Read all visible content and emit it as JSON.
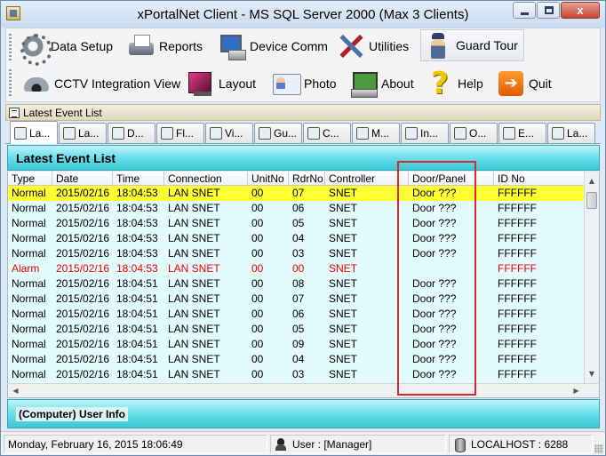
{
  "window": {
    "title": "xPortalNet Client - MS SQL Server 2000 (Max 3 Clients)",
    "controls": {
      "minimize": "",
      "maximize": "",
      "close": "x"
    }
  },
  "toolbar": {
    "row1": [
      {
        "label": "Data Setup",
        "icon": "gear-icon"
      },
      {
        "label": "Reports",
        "icon": "printer-icon"
      },
      {
        "label": "Device Comm",
        "icon": "device-comm-icon"
      },
      {
        "label": "Utilities",
        "icon": "tools-icon"
      },
      {
        "label": "Guard Tour",
        "icon": "guard-icon",
        "pressed": true
      }
    ],
    "row2": [
      {
        "label": "CCTV Integration View",
        "icon": "cctv-camera-icon"
      },
      {
        "label": "Layout",
        "icon": "monitor-icon"
      },
      {
        "label": "Photo",
        "icon": "photo-id-icon"
      },
      {
        "label": "About",
        "icon": "computer-icon"
      },
      {
        "label": "Help",
        "icon": "question-icon"
      },
      {
        "label": "Quit",
        "icon": "exit-icon"
      }
    ]
  },
  "panel": {
    "header": "Latest Event List"
  },
  "tabs": [
    {
      "label": "La...",
      "active": true
    },
    {
      "label": "La..."
    },
    {
      "label": "D..."
    },
    {
      "label": "Fl..."
    },
    {
      "label": "Vi..."
    },
    {
      "label": "Gu..."
    },
    {
      "label": "C..."
    },
    {
      "label": "M..."
    },
    {
      "label": "In..."
    },
    {
      "label": "O..."
    },
    {
      "label": "E..."
    },
    {
      "label": "La..."
    }
  ],
  "event_list": {
    "title": "Latest Event List",
    "columns": [
      "Type",
      "Date",
      "Time",
      "Connection",
      "UnitNo",
      "RdrNo",
      "Controller",
      "Door/Panel",
      "ID No"
    ],
    "rows": [
      [
        "Normal",
        "2015/02/16",
        "18:04:53",
        "LAN SNET",
        "00",
        "07",
        "SNET",
        "Door ???",
        "FFFFFF"
      ],
      [
        "Normal",
        "2015/02/16",
        "18:04:53",
        "LAN SNET",
        "00",
        "06",
        "SNET",
        "Door ???",
        "FFFFFF"
      ],
      [
        "Normal",
        "2015/02/16",
        "18:04:53",
        "LAN SNET",
        "00",
        "05",
        "SNET",
        "Door ???",
        "FFFFFF"
      ],
      [
        "Normal",
        "2015/02/16",
        "18:04:53",
        "LAN SNET",
        "00",
        "04",
        "SNET",
        "Door ???",
        "FFFFFF"
      ],
      [
        "Normal",
        "2015/02/16",
        "18:04:53",
        "LAN SNET",
        "00",
        "03",
        "SNET",
        "Door ???",
        "FFFFFF"
      ],
      [
        "Alarm",
        "2015/02/16",
        "18:04:53",
        "LAN SNET",
        "00",
        "00",
        "SNET",
        "",
        "FFFFFF"
      ],
      [
        "Normal",
        "2015/02/16",
        "18:04:51",
        "LAN SNET",
        "00",
        "08",
        "SNET",
        "Door ???",
        "FFFFFF"
      ],
      [
        "Normal",
        "2015/02/16",
        "18:04:51",
        "LAN SNET",
        "00",
        "07",
        "SNET",
        "Door ???",
        "FFFFFF"
      ],
      [
        "Normal",
        "2015/02/16",
        "18:04:51",
        "LAN SNET",
        "00",
        "06",
        "SNET",
        "Door ???",
        "FFFFFF"
      ],
      [
        "Normal",
        "2015/02/16",
        "18:04:51",
        "LAN SNET",
        "00",
        "05",
        "SNET",
        "Door ???",
        "FFFFFF"
      ],
      [
        "Normal",
        "2015/02/16",
        "18:04:51",
        "LAN SNET",
        "00",
        "09",
        "SNET",
        "Door ???",
        "FFFFFF"
      ],
      [
        "Normal",
        "2015/02/16",
        "18:04:51",
        "LAN SNET",
        "00",
        "04",
        "SNET",
        "Door ???",
        "FFFFFF"
      ],
      [
        "Normal",
        "2015/02/16",
        "18:04:51",
        "LAN SNET",
        "00",
        "03",
        "SNET",
        "Door ???",
        "FFFFFF"
      ]
    ],
    "selected_row": 0,
    "alarm_color": "#ee0000",
    "selected_color": "#ffff33"
  },
  "user_info": {
    "title": "(Computer) User Info"
  },
  "status": {
    "datetime": "Monday, February 16, 2015 18:06:49",
    "user": "User : [Manager]",
    "server": "LOCALHOST : 6288"
  }
}
